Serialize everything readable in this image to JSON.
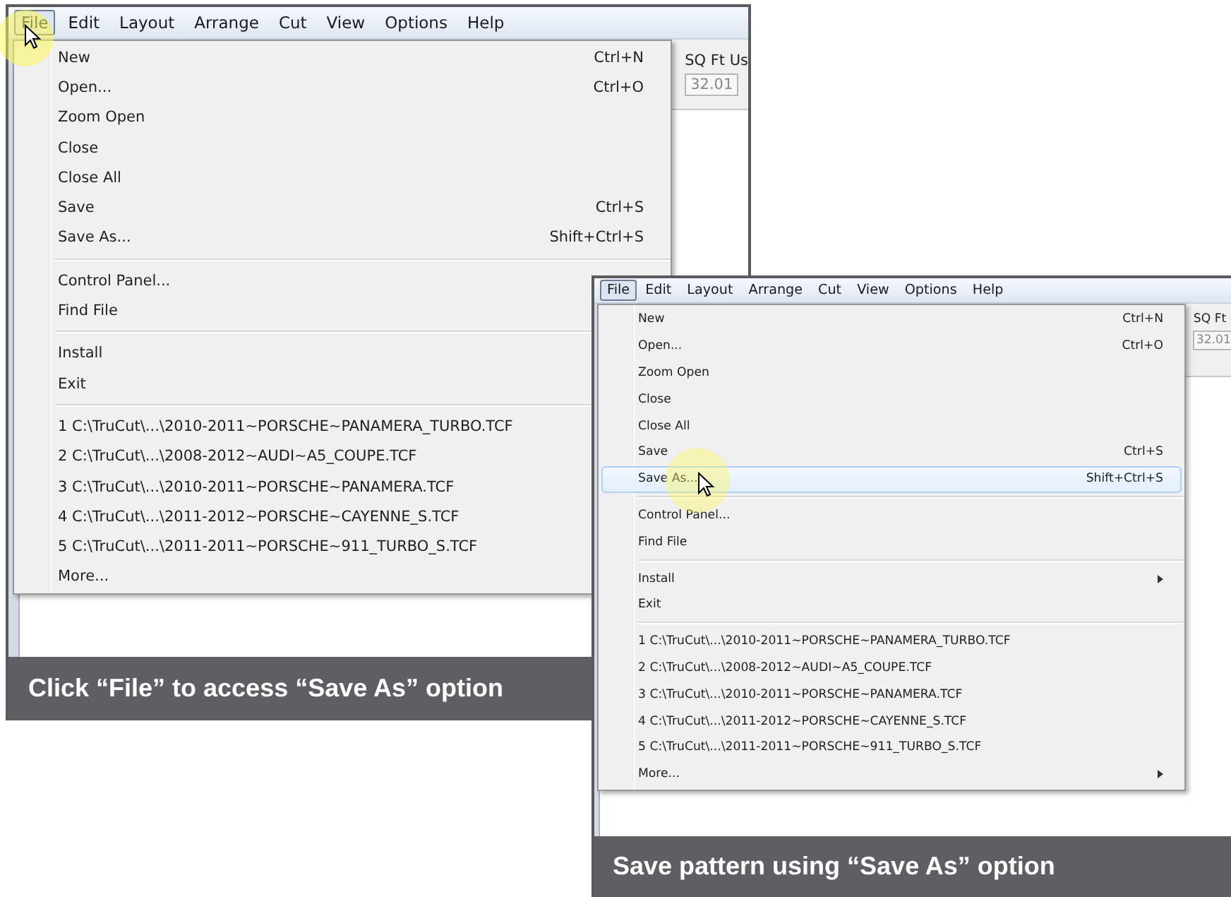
{
  "panels": [
    {
      "menubar": [
        {
          "label": "File",
          "selected": true
        },
        {
          "label": "Edit",
          "selected": false
        },
        {
          "label": "Layout",
          "selected": false
        },
        {
          "label": "Arrange",
          "selected": false
        },
        {
          "label": "Cut",
          "selected": false
        },
        {
          "label": "View",
          "selected": false
        },
        {
          "label": "Options",
          "selected": false
        },
        {
          "label": "Help",
          "selected": false
        }
      ],
      "menu": [
        {
          "kind": "item",
          "label": "New",
          "shortcut": "Ctrl+N",
          "selected": false,
          "submenu": false
        },
        {
          "kind": "item",
          "label": "Open...",
          "shortcut": "Ctrl+O",
          "selected": false,
          "submenu": false
        },
        {
          "kind": "item",
          "label": "Zoom Open",
          "selected": false,
          "submenu": false
        },
        {
          "kind": "item",
          "label": "Close",
          "selected": false,
          "submenu": false
        },
        {
          "kind": "item",
          "label": "Close All",
          "selected": false,
          "submenu": false
        },
        {
          "kind": "item",
          "label": "Save",
          "shortcut": "Ctrl+S",
          "selected": false,
          "submenu": false
        },
        {
          "kind": "item",
          "label": "Save As...",
          "shortcut": "Shift+Ctrl+S",
          "selected": false,
          "submenu": false
        },
        {
          "kind": "separator"
        },
        {
          "kind": "item",
          "label": "Control Panel...",
          "selected": false,
          "submenu": false
        },
        {
          "kind": "item",
          "label": "Find File",
          "selected": false,
          "submenu": false
        },
        {
          "kind": "separator"
        },
        {
          "kind": "item",
          "label": "Install",
          "selected": false,
          "submenu": false
        },
        {
          "kind": "item",
          "label": "Exit",
          "selected": false,
          "submenu": false
        },
        {
          "kind": "separator"
        },
        {
          "kind": "item",
          "label": "1 C:\\TruCut\\...\\2010-2011~PORSCHE~PANAMERA_TURBO.TCF",
          "selected": false,
          "submenu": false
        },
        {
          "kind": "item",
          "label": "2 C:\\TruCut\\...\\2008-2012~AUDI~A5_COUPE.TCF",
          "selected": false,
          "submenu": false
        },
        {
          "kind": "item",
          "label": "3 C:\\TruCut\\...\\2010-2011~PORSCHE~PANAMERA.TCF",
          "selected": false,
          "submenu": false
        },
        {
          "kind": "item",
          "label": "4 C:\\TruCut\\...\\2011-2012~PORSCHE~CAYENNE_S.TCF",
          "selected": false,
          "submenu": false
        },
        {
          "kind": "item",
          "label": "5 C:\\TruCut\\...\\2011-2011~PORSCHE~911_TURBO_S.TCF",
          "selected": false,
          "submenu": false
        },
        {
          "kind": "item",
          "label": "More...",
          "selected": false,
          "submenu": false
        }
      ],
      "side_label": "SQ Ft Us",
      "side_value": "32.01",
      "caption": "Click “File” to access “Save As” option"
    },
    {
      "menubar": [
        {
          "label": "File",
          "selected": true
        },
        {
          "label": "Edit",
          "selected": false
        },
        {
          "label": "Layout",
          "selected": false
        },
        {
          "label": "Arrange",
          "selected": false
        },
        {
          "label": "Cut",
          "selected": false
        },
        {
          "label": "View",
          "selected": false
        },
        {
          "label": "Options",
          "selected": false
        },
        {
          "label": "Help",
          "selected": false
        }
      ],
      "menu": [
        {
          "kind": "item",
          "label": "New",
          "shortcut": "Ctrl+N",
          "selected": false,
          "submenu": false
        },
        {
          "kind": "item",
          "label": "Open...",
          "shortcut": "Ctrl+O",
          "selected": false,
          "submenu": false
        },
        {
          "kind": "item",
          "label": "Zoom Open",
          "selected": false,
          "submenu": false
        },
        {
          "kind": "item",
          "label": "Close",
          "selected": false,
          "submenu": false
        },
        {
          "kind": "item",
          "label": "Close All",
          "selected": false,
          "submenu": false
        },
        {
          "kind": "item",
          "label": "Save",
          "shortcut": "Ctrl+S",
          "selected": false,
          "submenu": false
        },
        {
          "kind": "item",
          "label": "Save As...",
          "shortcut": "Shift+Ctrl+S",
          "selected": true,
          "submenu": false
        },
        {
          "kind": "separator"
        },
        {
          "kind": "item",
          "label": "Control Panel...",
          "selected": false,
          "submenu": false
        },
        {
          "kind": "item",
          "label": "Find File",
          "selected": false,
          "submenu": false
        },
        {
          "kind": "separator"
        },
        {
          "kind": "item",
          "label": "Install",
          "selected": false,
          "submenu": true
        },
        {
          "kind": "item",
          "label": "Exit",
          "selected": false,
          "submenu": false
        },
        {
          "kind": "separator"
        },
        {
          "kind": "item",
          "label": "1 C:\\TruCut\\...\\2010-2011~PORSCHE~PANAMERA_TURBO.TCF",
          "selected": false,
          "submenu": false
        },
        {
          "kind": "item",
          "label": "2 C:\\TruCut\\...\\2008-2012~AUDI~A5_COUPE.TCF",
          "selected": false,
          "submenu": false
        },
        {
          "kind": "item",
          "label": "3 C:\\TruCut\\...\\2010-2011~PORSCHE~PANAMERA.TCF",
          "selected": false,
          "submenu": false
        },
        {
          "kind": "item",
          "label": "4 C:\\TruCut\\...\\2011-2012~PORSCHE~CAYENNE_S.TCF",
          "selected": false,
          "submenu": false
        },
        {
          "kind": "item",
          "label": "5 C:\\TruCut\\...\\2011-2011~PORSCHE~911_TURBO_S.TCF",
          "selected": false,
          "submenu": false
        },
        {
          "kind": "item",
          "label": "More...",
          "selected": false,
          "submenu": true
        }
      ],
      "side_label": "SQ Ft",
      "side_value": "32.01",
      "caption": "Save pattern using “Save As” option"
    }
  ]
}
